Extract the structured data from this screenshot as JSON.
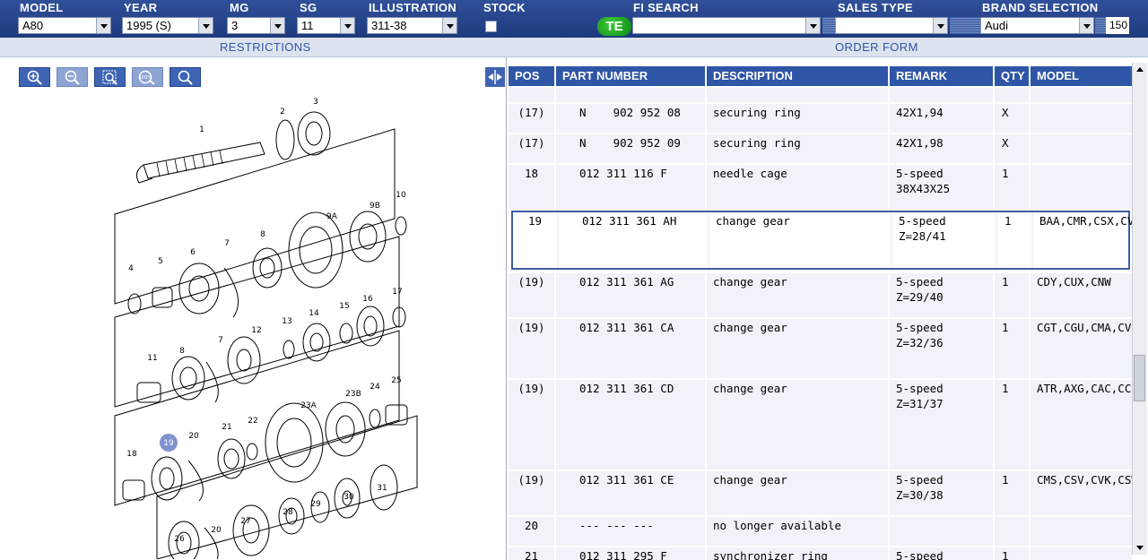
{
  "topbar": {
    "model_label": "MODEL",
    "model_value": "A80",
    "year_label": "YEAR",
    "year_value": "1995 (S)",
    "mg_label": "MG",
    "mg_value": "3",
    "sg_label": "SG",
    "sg_value": "11",
    "illustration_label": "ILLUSTRATION",
    "illustration_value": "311-38",
    "stock_label": "STOCK",
    "fi_search_label": "FI SEARCH",
    "te_badge": "TE",
    "fi_search_value": "",
    "sales_type_label": "SALES TYPE",
    "sales_type_value": "",
    "brand_label": "BRAND SELECTION",
    "brand_value": "Audi",
    "brand_number": "150"
  },
  "sections": {
    "restrictions": "RESTRICTIONS",
    "order_form": "ORDER FORM"
  },
  "zoom_tools": [
    "zoom-in-icon",
    "zoom-out-icon",
    "zoom-area-icon",
    "zoom-100-icon",
    "search-icon"
  ],
  "zoom_100_text": "100%",
  "diagram_callouts": [
    "1",
    "2",
    "3",
    "4",
    "5",
    "6",
    "7",
    "8",
    "9A",
    "9B",
    "10",
    "11",
    "8",
    "7",
    "12",
    "13",
    "14",
    "15",
    "16",
    "17",
    "18",
    "19",
    "20",
    "21",
    "22",
    "23A",
    "23B",
    "24",
    "25",
    "26",
    "20",
    "27",
    "28",
    "29",
    "30",
    "31"
  ],
  "diagram_highlight": "19",
  "table": {
    "headers": [
      "POS",
      "PART NUMBER",
      "DESCRIPTION",
      "REMARK",
      "QTY",
      "MODEL"
    ],
    "rows": [
      {
        "pos": "(17)",
        "pn": "N    902 952 08",
        "desc": "securing ring",
        "rem": "42X1,94",
        "qty": "X",
        "model": ""
      },
      {
        "pos": "(17)",
        "pn": "N    902 952 09",
        "desc": "securing ring",
        "rem": "42X1,98",
        "qty": "X",
        "model": ""
      },
      {
        "pos": "18",
        "pn": "012 311 116 F",
        "desc": "needle cage",
        "rem": "5-speed 38X43X25",
        "qty": "1",
        "model": ""
      },
      {
        "pos": "19",
        "pn": "012 311 361 AH",
        "desc": "change gear",
        "rem": "5-speed Z=28/41",
        "qty": "1",
        "model": "BAA,CMR,CSX,CVC,CVJ,CPC,CSY,CMR"
      },
      {
        "pos": "(19)",
        "pn": "012 311 361 AG",
        "desc": "change gear",
        "rem": "5-speed Z=29/40",
        "qty": "1",
        "model": "CDY,CUX,CNW"
      },
      {
        "pos": "(19)",
        "pn": "012 311 361 CA",
        "desc": "change gear",
        "rem": "5-speed Z=32/36",
        "qty": "1",
        "model": "CGT,CGU,CMA,CVF,CVG,CVH,CPH,CPK,CPL"
      },
      {
        "pos": "(19)",
        "pn": "012 311 361 CD",
        "desc": "change gear",
        "rem": "5-speed Z=31/37",
        "qty": "1",
        "model": "ATR,AXG,CAC,CCF,CDX,CUY,CUZ,CVB,CVD,CVQ,CNX,CNY,CPB,CPE,CPD"
      },
      {
        "pos": "(19)",
        "pn": "012 311 361 CE",
        "desc": "change gear",
        "rem": "5-speed Z=30/38",
        "qty": "1",
        "model": "CMS,CSV,CVK,CSW"
      },
      {
        "pos": "20",
        "pn": "--- --- ---",
        "desc": "no longer available",
        "rem": "",
        "qty": "",
        "model": ""
      },
      {
        "pos": "21",
        "pn": "012 311 295 F",
        "desc": "synchronizer ring",
        "rem": "5-speed",
        "qty": "1",
        "model": ""
      }
    ],
    "selected_pos": "19"
  },
  "colors": {
    "header_blue": "#2f55a6",
    "row_bg": "#f0f3f9",
    "badge_green": "#1aa81c",
    "callout_highlight": "#7f93cf"
  }
}
